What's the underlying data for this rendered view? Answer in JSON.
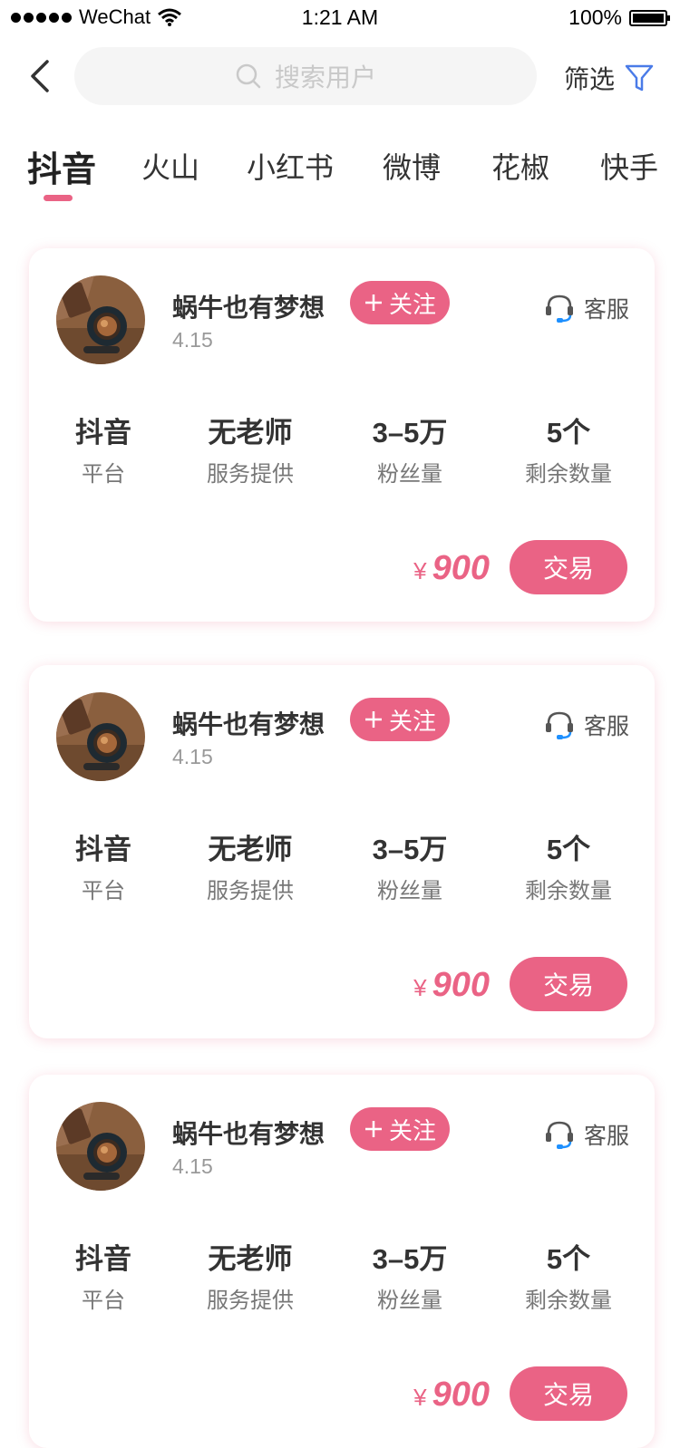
{
  "status_bar": {
    "carrier": "WeChat",
    "time": "1:21 AM",
    "battery": "100%"
  },
  "header": {
    "search_placeholder": "搜索用户",
    "filter_label": "筛选"
  },
  "tabs": [
    {
      "label": "抖音",
      "active": true
    },
    {
      "label": "火山",
      "active": false
    },
    {
      "label": "小红书",
      "active": false
    },
    {
      "label": "微博",
      "active": false
    },
    {
      "label": "花椒",
      "active": false
    },
    {
      "label": "快手",
      "active": false
    }
  ],
  "colors": {
    "accent": "#ea6385",
    "headset_blue": "#1e90ff"
  },
  "cards": [
    {
      "name": "蜗牛也有梦想",
      "date": "4.15",
      "follow_label": "关注",
      "service_label": "客服",
      "stats": [
        {
          "value": "抖音",
          "label": "平台"
        },
        {
          "value": "无老师",
          "label": "服务提供"
        },
        {
          "value": "3–5万",
          "label": "粉丝量"
        },
        {
          "value": "5个",
          "label": "剩余数量"
        }
      ],
      "currency": "¥",
      "price": "900",
      "trade_label": "交易"
    },
    {
      "name": "蜗牛也有梦想",
      "date": "4.15",
      "follow_label": "关注",
      "service_label": "客服",
      "stats": [
        {
          "value": "抖音",
          "label": "平台"
        },
        {
          "value": "无老师",
          "label": "服务提供"
        },
        {
          "value": "3–5万",
          "label": "粉丝量"
        },
        {
          "value": "5个",
          "label": "剩余数量"
        }
      ],
      "currency": "¥",
      "price": "900",
      "trade_label": "交易"
    },
    {
      "name": "蜗牛也有梦想",
      "date": "4.15",
      "follow_label": "关注",
      "service_label": "客服",
      "stats": [
        {
          "value": "抖音",
          "label": "平台"
        },
        {
          "value": "无老师",
          "label": "服务提供"
        },
        {
          "value": "3–5万",
          "label": "粉丝量"
        },
        {
          "value": "5个",
          "label": "剩余数量"
        }
      ],
      "currency": "¥",
      "price": "900",
      "trade_label": "交易"
    }
  ]
}
